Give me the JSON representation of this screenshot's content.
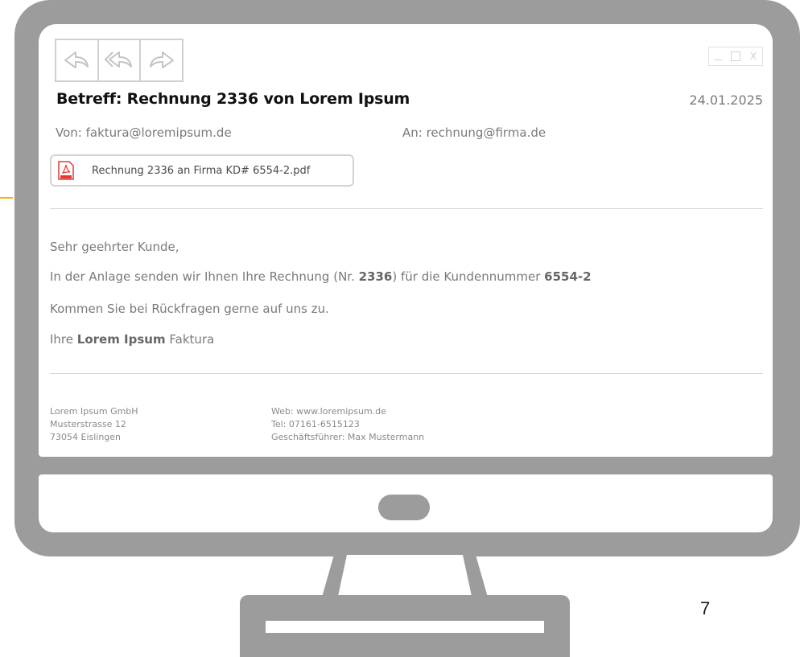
{
  "email": {
    "subject": "Betreff: Rechnung 2336 von Lorem Ipsum",
    "date": "24.01.2025",
    "from": "Von: faktura@loremipsum.de",
    "to": "An: rechnung@firma.de",
    "attachment": {
      "icon": "pdf-icon",
      "filename": "Rechnung 2336 an Firma KD# 6554-2.pdf"
    },
    "body": {
      "greeting": "Sehr geehrter Kunde,",
      "line2_prefix": "In der Anlage senden wir Ihnen Ihre Rechnung (Nr. ",
      "invoice_number": "2336",
      "line2_middle": ") für die Kundennummer ",
      "customer_number": "6554-2",
      "line3": "Kommen Sie bei Rückfragen gerne auf uns zu.",
      "sign_prefix": "Ihre ",
      "sign_company": "Lorem Ipsum",
      "sign_suffix": " Faktura"
    },
    "footer": {
      "company": "Lorem Ipsum GmbH",
      "street": "Musterstrasse 12",
      "city": "73054 Eislingen",
      "web": "Web: www.loremipsum.de",
      "tel": "Tel: 07161-6515123",
      "ceo": "Geschäftsführer: Max Mustermann"
    }
  },
  "toolbar": {
    "icons": [
      "reply-icon",
      "reply-all-icon",
      "forward-icon"
    ]
  },
  "window_controls": {
    "minimize_icon": "minimize-icon",
    "maximize_icon": "maximize-icon",
    "close_label": "X"
  },
  "page_number": "7",
  "colors": {
    "frame": "#9c9c9c",
    "accent": "#f2b600",
    "pdf_red": "#e53935"
  }
}
